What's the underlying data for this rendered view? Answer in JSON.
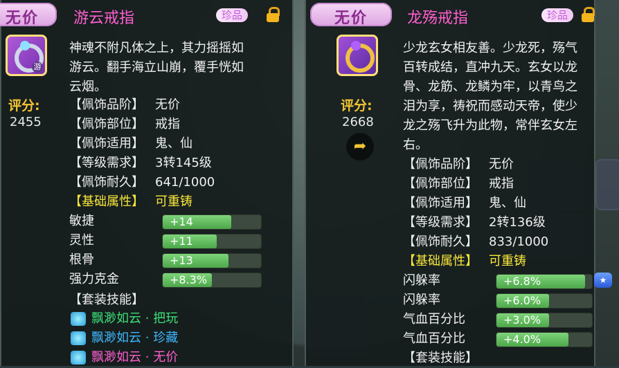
{
  "left": {
    "grade_ribbon": "无价",
    "title": "游云戒指",
    "grade_tag": "珍品",
    "icon_tag": "游",
    "score_label": "评分:",
    "score": "2455",
    "description_lines": [
      "神魂不附凡体之上，其力摇摇如",
      "游云。翻手海立山崩，覆手恍如",
      "云烟。"
    ],
    "properties": [
      {
        "label": "【佩饰品阶】",
        "value": "无价"
      },
      {
        "label": "【佩饰部位】",
        "value": "戒指"
      },
      {
        "label": "【佩饰适用】",
        "value": "鬼、仙"
      },
      {
        "label": "【等级需求】",
        "value": "3转145级"
      },
      {
        "label": "【佩饰耐久】",
        "value": "641/1000"
      }
    ],
    "basic_label": "【基础属性】",
    "basic_value": "可重铸",
    "attributes": [
      {
        "name": "敏捷",
        "value": "+14",
        "fill": 0.7
      },
      {
        "name": "灵性",
        "value": "+11",
        "fill": 0.55
      },
      {
        "name": "根骨",
        "value": "+13",
        "fill": 0.67
      },
      {
        "name": "强力克金",
        "value": "+8.3%",
        "fill": 0.5
      }
    ],
    "set_label": "【套装技能】",
    "skills": [
      {
        "name": "飘渺如云",
        "sep": "·",
        "tier": "把玩",
        "color": "#3de07a"
      },
      {
        "name": "飘渺如云",
        "sep": "·",
        "tier": "珍藏",
        "color": "#3fb8ff"
      },
      {
        "name": "飘渺如云",
        "sep": "·",
        "tier": "无价",
        "color": "#ff5fd0"
      }
    ]
  },
  "right": {
    "grade_ribbon": "无价",
    "title": "龙殇戒指",
    "grade_tag": "珍品",
    "score_label": "评分:",
    "score": "2668",
    "share_icon": "share-icon",
    "description_lines": [
      "少龙玄女相友善。少龙死，殇气",
      "百转成结，直冲九天。玄女以龙",
      "骨、龙筋、龙鳞为牢，以青鸟之",
      "泪为享，祷祝而感动天帝，使少",
      "龙之殇飞升为此物，常伴玄女左",
      "右。"
    ],
    "properties": [
      {
        "label": "【佩饰品阶】",
        "value": "无价"
      },
      {
        "label": "【佩饰部位】",
        "value": "戒指"
      },
      {
        "label": "【佩饰适用】",
        "value": "鬼、仙"
      },
      {
        "label": "【等级需求】",
        "value": "2转136级"
      },
      {
        "label": "【佩饰耐久】",
        "value": "833/1000"
      }
    ],
    "basic_label": "【基础属性】",
    "basic_value": "可重铸",
    "attributes": [
      {
        "name": "闪躲率",
        "value": "+6.8%",
        "fill": 0.93
      },
      {
        "name": "闪躲率",
        "value": "+6.0%",
        "fill": 0.55
      },
      {
        "name": "气血百分比",
        "value": "+3.0%",
        "fill": 0.55
      },
      {
        "name": "气血百分比",
        "value": "+4.0%",
        "fill": 0.75
      }
    ],
    "set_label": "【套装技能】"
  },
  "colors": {
    "title": "#ff5fd0",
    "basic": "#fae73a",
    "score": "#f4c534",
    "bar_fill": "#4da74a"
  }
}
